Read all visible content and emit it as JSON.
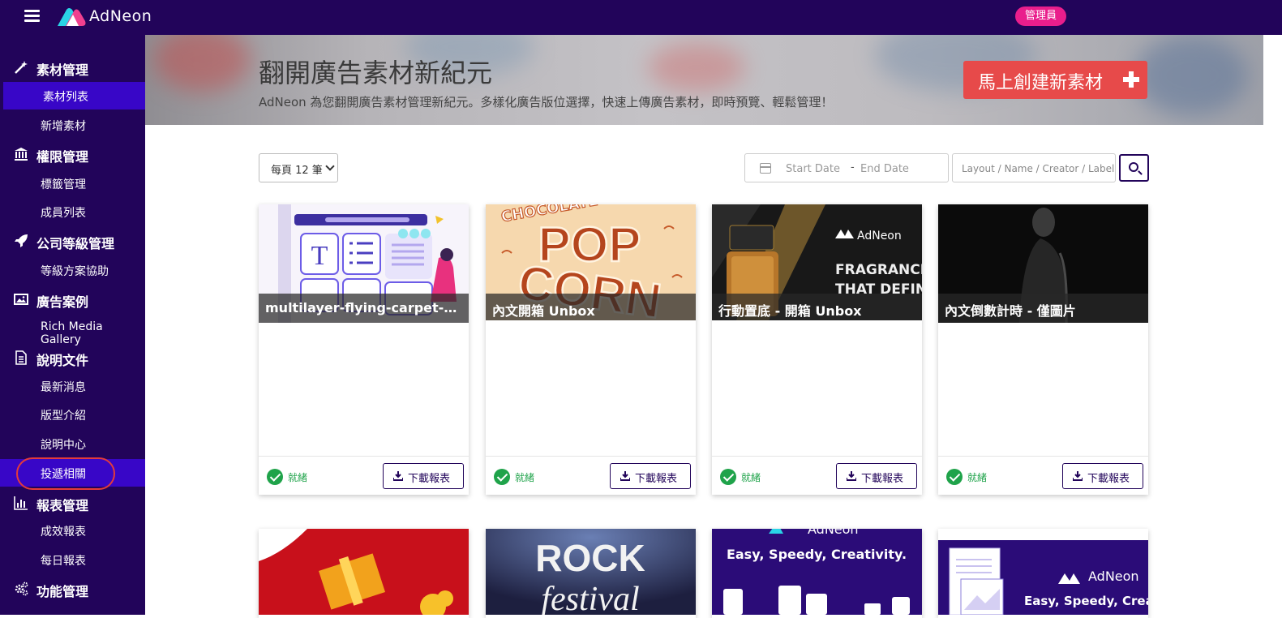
{
  "header": {
    "logo_text": "AdNeon",
    "role_badge": "管理員"
  },
  "sidebar": {
    "sections": [
      {
        "label": "素材管理",
        "icon": "magic-wand-icon",
        "items": [
          "素材列表",
          "新增素材"
        ]
      },
      {
        "label": "權限管理",
        "icon": "bank-icon",
        "items": [
          "標籤管理",
          "成員列表"
        ]
      },
      {
        "label": "公司等級管理",
        "icon": "rocket-icon",
        "items": [
          "等級方案協助"
        ]
      },
      {
        "label": "廣告案例",
        "icon": "image-icon",
        "items": [
          "Rich Media Gallery"
        ]
      },
      {
        "label": "說明文件",
        "icon": "document-icon",
        "items": [
          "最新消息",
          "版型介紹",
          "說明中心",
          "投遞相關"
        ]
      },
      {
        "label": "報表管理",
        "icon": "bar-chart-icon",
        "items": [
          "成效報表",
          "每日報表"
        ]
      },
      {
        "label": "功能管理",
        "icon": "gears-icon",
        "items": []
      }
    ],
    "active_item": "素材列表",
    "highlighted_item": "投遞相關"
  },
  "banner": {
    "title": "翻開廣告素材新紀元",
    "subtitle": "AdNeon 為您翻開廣告素材管理新紀元。多樣化廣告版位選擇，快速上傳廣告素材，即時預覽、輕鬆管理！",
    "create_button": "馬上創建新素材"
  },
  "filters": {
    "per_page": "每頁 12 筆",
    "start_date_placeholder": "Start Date",
    "date_separator": "-",
    "end_date_placeholder": "End Date",
    "search_placeholder": "Layout / Name / Creator / Label"
  },
  "cards": [
    {
      "title": "multilayer-flying-carpet-com...",
      "status": "就緒",
      "download": "下載報表"
    },
    {
      "title": "內文開箱 Unbox",
      "status": "就緒",
      "download": "下載報表"
    },
    {
      "title": "行動置底 - 開箱 Unbox",
      "status": "就緒",
      "download": "下載報表"
    },
    {
      "title": "內文倒數計時 - 僅圖片",
      "status": "就緒",
      "download": "下載報表"
    }
  ],
  "thumb_text": {
    "popcorn_top": "CHOCOLATE",
    "popcorn_main_1": "POP",
    "popcorn_main_2": "CORN",
    "fragrance_brand": "AdNeon",
    "fragrance_line1": "FRAGRANCES",
    "fragrance_line2": "THAT DEFINES",
    "rock_1": "ROCK",
    "rock_2": "festival",
    "promo_brand": "AdNeon",
    "promo_tagline": "Easy, Speedy, Creativity.",
    "promo2_brand": "AdNeon",
    "promo2_tagline": "Easy, Speedy, Creativ"
  },
  "colors": {
    "nav_bg": "#22045a",
    "nav_active": "#3806c7",
    "badge": "#e91e8c",
    "create_btn": "#e74a4a",
    "ready_green": "#1fa34a"
  }
}
